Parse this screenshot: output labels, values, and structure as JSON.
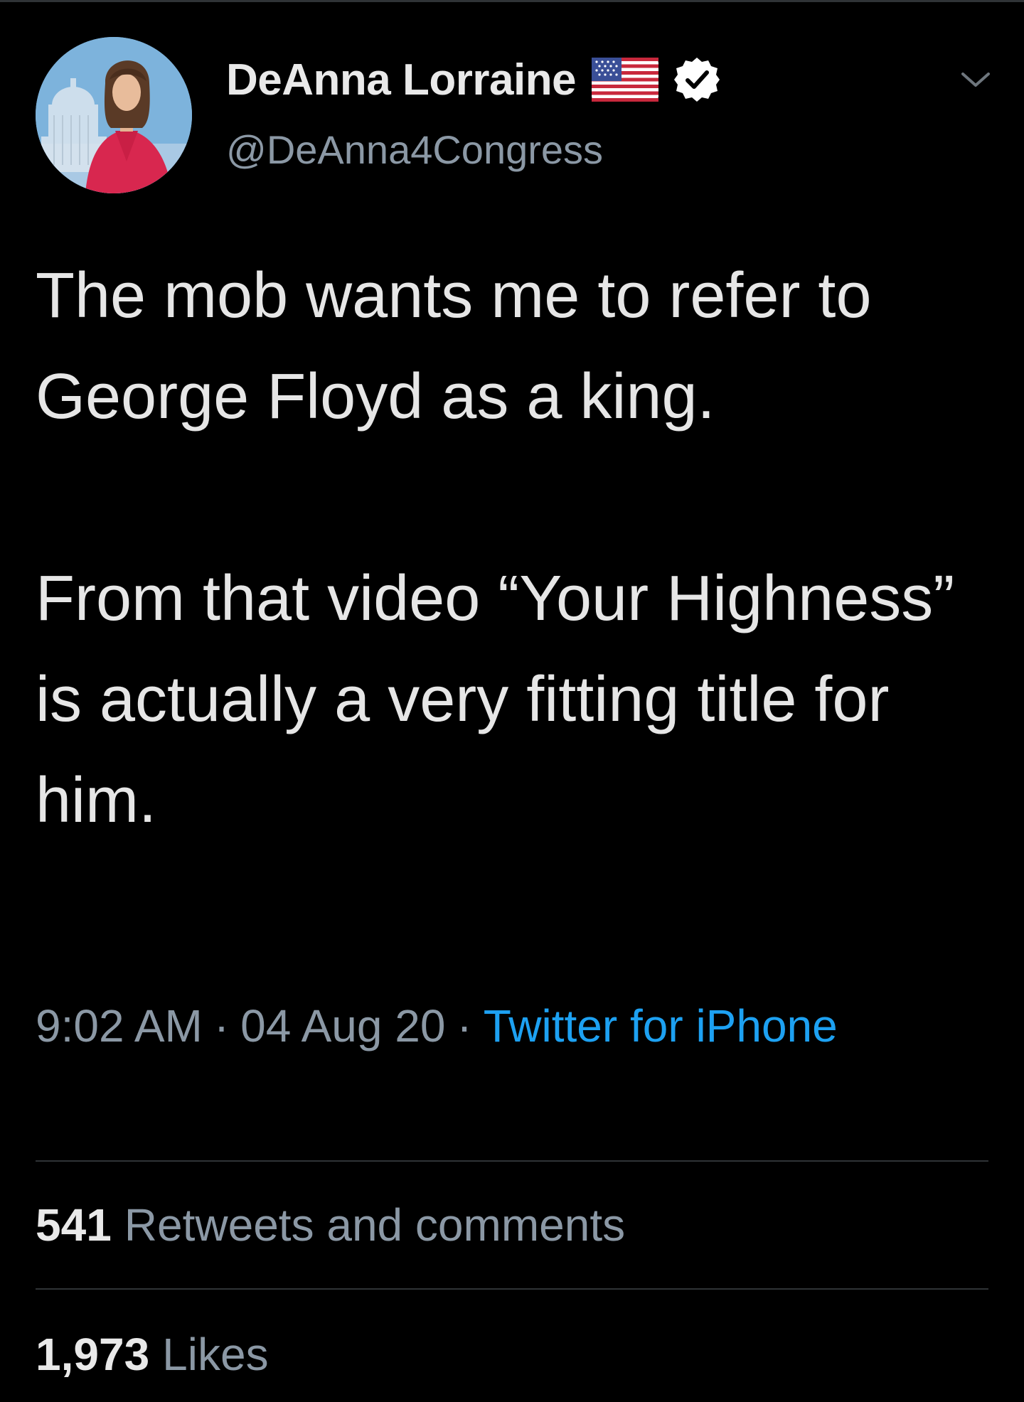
{
  "author": {
    "display_name": "DeAnna Lorraine",
    "handle": "@DeAnna4Congress",
    "avatar_icon": "profile-photo",
    "flag_icon": "us-flag-icon",
    "verified_icon": "verified-badge-icon"
  },
  "tweet": {
    "paragraphs": [
      "The mob wants me to refer to George Floyd as a king.",
      "From that video “Your Highness” is actually a very fitting title for him."
    ]
  },
  "meta": {
    "time": "9:02 AM",
    "separator": "·",
    "date": "04 Aug 20",
    "source": "Twitter for iPhone"
  },
  "stats": {
    "retweets_count": "541",
    "retweets_label": "Retweets and comments",
    "likes_count": "1,973",
    "likes_label": "Likes"
  },
  "colors": {
    "background": "#000000",
    "text": "#e6e6e6",
    "secondary_text": "#8b98a5",
    "link": "#1da1f2",
    "divider": "#2f3336"
  }
}
